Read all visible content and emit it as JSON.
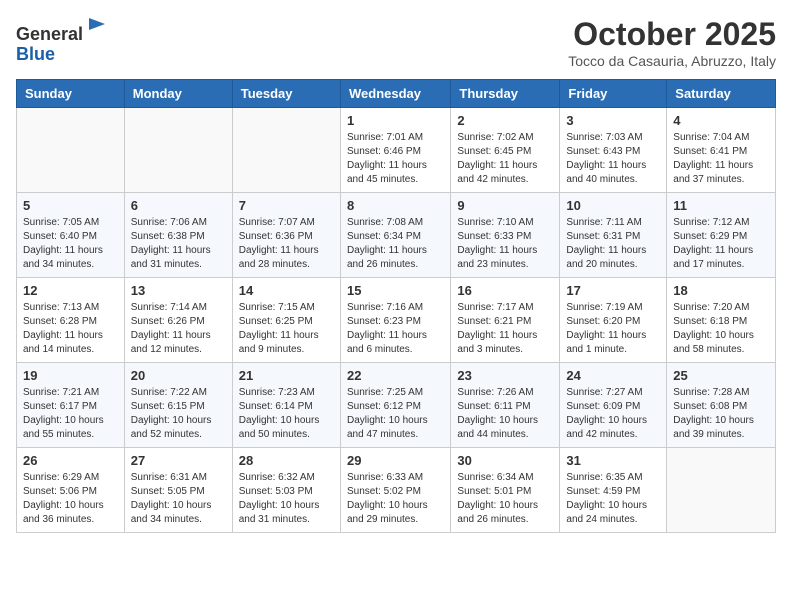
{
  "header": {
    "logo_general": "General",
    "logo_blue": "Blue",
    "month_title": "October 2025",
    "subtitle": "Tocco da Casauria, Abruzzo, Italy"
  },
  "days_of_week": [
    "Sunday",
    "Monday",
    "Tuesday",
    "Wednesday",
    "Thursday",
    "Friday",
    "Saturday"
  ],
  "weeks": [
    [
      {
        "day": "",
        "info": ""
      },
      {
        "day": "",
        "info": ""
      },
      {
        "day": "",
        "info": ""
      },
      {
        "day": "1",
        "info": "Sunrise: 7:01 AM\nSunset: 6:46 PM\nDaylight: 11 hours\nand 45 minutes."
      },
      {
        "day": "2",
        "info": "Sunrise: 7:02 AM\nSunset: 6:45 PM\nDaylight: 11 hours\nand 42 minutes."
      },
      {
        "day": "3",
        "info": "Sunrise: 7:03 AM\nSunset: 6:43 PM\nDaylight: 11 hours\nand 40 minutes."
      },
      {
        "day": "4",
        "info": "Sunrise: 7:04 AM\nSunset: 6:41 PM\nDaylight: 11 hours\nand 37 minutes."
      }
    ],
    [
      {
        "day": "5",
        "info": "Sunrise: 7:05 AM\nSunset: 6:40 PM\nDaylight: 11 hours\nand 34 minutes."
      },
      {
        "day": "6",
        "info": "Sunrise: 7:06 AM\nSunset: 6:38 PM\nDaylight: 11 hours\nand 31 minutes."
      },
      {
        "day": "7",
        "info": "Sunrise: 7:07 AM\nSunset: 6:36 PM\nDaylight: 11 hours\nand 28 minutes."
      },
      {
        "day": "8",
        "info": "Sunrise: 7:08 AM\nSunset: 6:34 PM\nDaylight: 11 hours\nand 26 minutes."
      },
      {
        "day": "9",
        "info": "Sunrise: 7:10 AM\nSunset: 6:33 PM\nDaylight: 11 hours\nand 23 minutes."
      },
      {
        "day": "10",
        "info": "Sunrise: 7:11 AM\nSunset: 6:31 PM\nDaylight: 11 hours\nand 20 minutes."
      },
      {
        "day": "11",
        "info": "Sunrise: 7:12 AM\nSunset: 6:29 PM\nDaylight: 11 hours\nand 17 minutes."
      }
    ],
    [
      {
        "day": "12",
        "info": "Sunrise: 7:13 AM\nSunset: 6:28 PM\nDaylight: 11 hours\nand 14 minutes."
      },
      {
        "day": "13",
        "info": "Sunrise: 7:14 AM\nSunset: 6:26 PM\nDaylight: 11 hours\nand 12 minutes."
      },
      {
        "day": "14",
        "info": "Sunrise: 7:15 AM\nSunset: 6:25 PM\nDaylight: 11 hours\nand 9 minutes."
      },
      {
        "day": "15",
        "info": "Sunrise: 7:16 AM\nSunset: 6:23 PM\nDaylight: 11 hours\nand 6 minutes."
      },
      {
        "day": "16",
        "info": "Sunrise: 7:17 AM\nSunset: 6:21 PM\nDaylight: 11 hours\nand 3 minutes."
      },
      {
        "day": "17",
        "info": "Sunrise: 7:19 AM\nSunset: 6:20 PM\nDaylight: 11 hours\nand 1 minute."
      },
      {
        "day": "18",
        "info": "Sunrise: 7:20 AM\nSunset: 6:18 PM\nDaylight: 10 hours\nand 58 minutes."
      }
    ],
    [
      {
        "day": "19",
        "info": "Sunrise: 7:21 AM\nSunset: 6:17 PM\nDaylight: 10 hours\nand 55 minutes."
      },
      {
        "day": "20",
        "info": "Sunrise: 7:22 AM\nSunset: 6:15 PM\nDaylight: 10 hours\nand 52 minutes."
      },
      {
        "day": "21",
        "info": "Sunrise: 7:23 AM\nSunset: 6:14 PM\nDaylight: 10 hours\nand 50 minutes."
      },
      {
        "day": "22",
        "info": "Sunrise: 7:25 AM\nSunset: 6:12 PM\nDaylight: 10 hours\nand 47 minutes."
      },
      {
        "day": "23",
        "info": "Sunrise: 7:26 AM\nSunset: 6:11 PM\nDaylight: 10 hours\nand 44 minutes."
      },
      {
        "day": "24",
        "info": "Sunrise: 7:27 AM\nSunset: 6:09 PM\nDaylight: 10 hours\nand 42 minutes."
      },
      {
        "day": "25",
        "info": "Sunrise: 7:28 AM\nSunset: 6:08 PM\nDaylight: 10 hours\nand 39 minutes."
      }
    ],
    [
      {
        "day": "26",
        "info": "Sunrise: 6:29 AM\nSunset: 5:06 PM\nDaylight: 10 hours\nand 36 minutes."
      },
      {
        "day": "27",
        "info": "Sunrise: 6:31 AM\nSunset: 5:05 PM\nDaylight: 10 hours\nand 34 minutes."
      },
      {
        "day": "28",
        "info": "Sunrise: 6:32 AM\nSunset: 5:03 PM\nDaylight: 10 hours\nand 31 minutes."
      },
      {
        "day": "29",
        "info": "Sunrise: 6:33 AM\nSunset: 5:02 PM\nDaylight: 10 hours\nand 29 minutes."
      },
      {
        "day": "30",
        "info": "Sunrise: 6:34 AM\nSunset: 5:01 PM\nDaylight: 10 hours\nand 26 minutes."
      },
      {
        "day": "31",
        "info": "Sunrise: 6:35 AM\nSunset: 4:59 PM\nDaylight: 10 hours\nand 24 minutes."
      },
      {
        "day": "",
        "info": ""
      }
    ]
  ]
}
